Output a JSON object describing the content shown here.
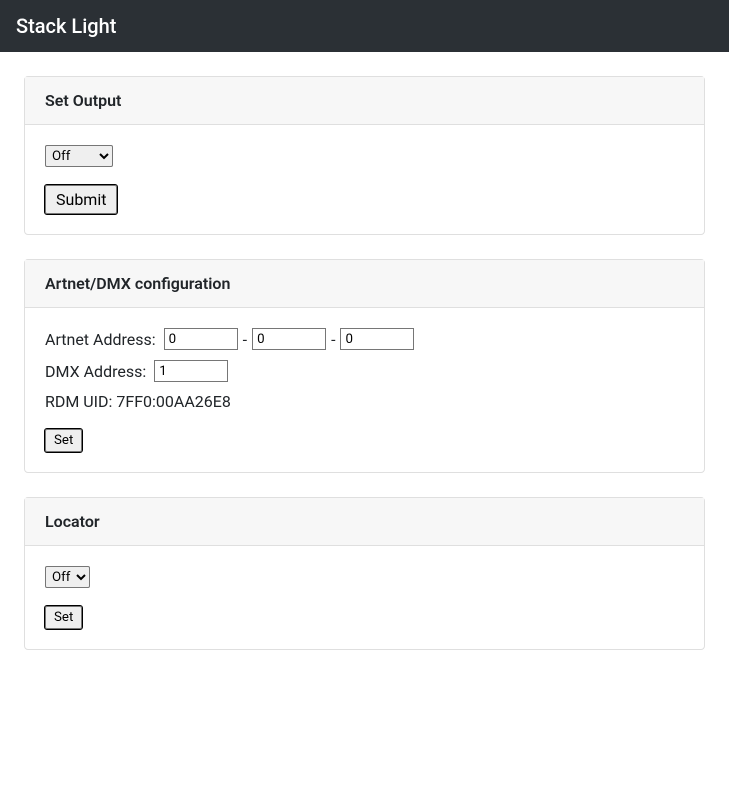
{
  "navbar": {
    "title": "Stack Light"
  },
  "setOutput": {
    "heading": "Set Output",
    "selected": "Off",
    "submitLabel": "Submit"
  },
  "artnetDmx": {
    "heading": "Artnet/DMX configuration",
    "artnetLabel": "Artnet Address:",
    "artnet1": "0",
    "artnet2": "0",
    "artnet3": "0",
    "dmxLabel": "DMX Address:",
    "dmxValue": "1",
    "rdmLabel": "RDM UID:",
    "rdmValue": "7FF0:00AA26E8",
    "setLabel": "Set"
  },
  "locator": {
    "heading": "Locator",
    "selected": "Off",
    "setLabel": "Set"
  }
}
